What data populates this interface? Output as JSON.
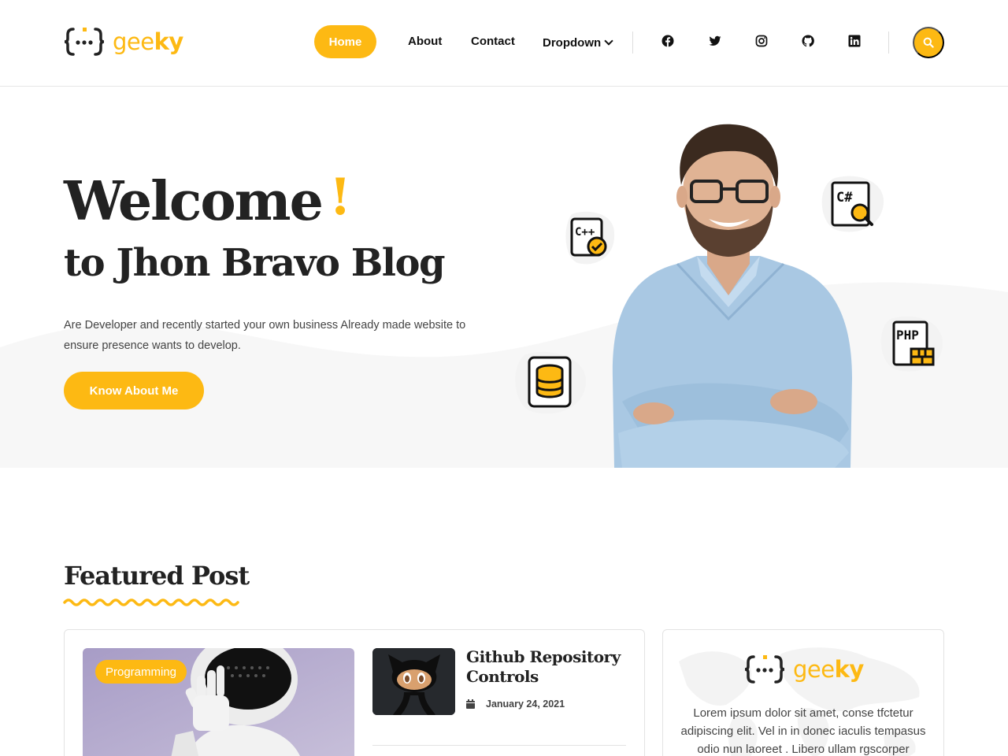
{
  "header": {
    "logo_text_light": "gee",
    "logo_text_bold": "ky",
    "nav": {
      "home": "Home",
      "about": "About",
      "contact": "Contact",
      "dropdown": "Dropdown"
    },
    "social_icons": [
      "facebook-icon",
      "twitter-icon",
      "instagram-icon",
      "github-icon",
      "linkedin-icon"
    ]
  },
  "hero": {
    "title": "Welcome",
    "exclaim": "!",
    "subtitle": "to Jhon Bravo Blog",
    "paragraph": "Are Developer and recently started your own business Already made website to ensure presence wants to develop.",
    "button": "Know About Me",
    "tech_badges": [
      "C++",
      "C#",
      "PHP"
    ]
  },
  "featured": {
    "title": "Featured Post",
    "main_post": {
      "tag": "Programming"
    },
    "side_post": {
      "title": "Github Repository Controls",
      "date": "January 24, 2021"
    },
    "about_card": {
      "logo_text_light": "gee",
      "logo_text_bold": "ky",
      "text": "Lorem ipsum dolor sit amet, conse tfctetur adipiscing elit. Vel in in donec iaculis tempasus odio nun laoreet . Libero ullam rgscorper"
    }
  },
  "colors": {
    "accent": "#fdb913",
    "text": "#222222",
    "muted": "#444444",
    "hero_bg_wave": "#f7f7f7"
  }
}
